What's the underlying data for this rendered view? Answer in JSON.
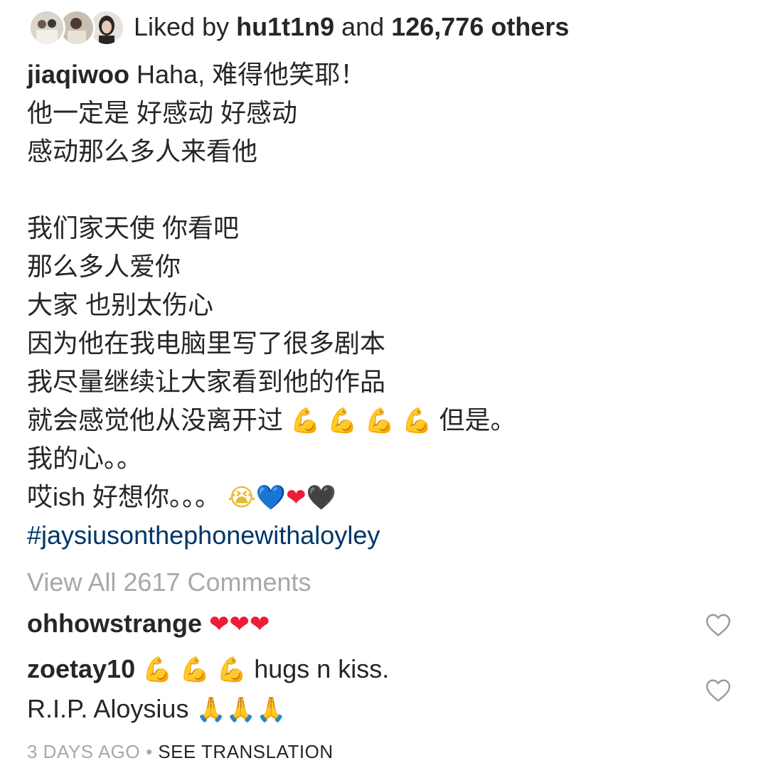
{
  "likes": {
    "prefix": "Liked by ",
    "user": "hu1t1n9",
    "middle": " and ",
    "count": "126,776 others"
  },
  "caption": {
    "username": "jiaqiwoo",
    "lines": [
      "Haha, 难得他笑耶！",
      "他一定是 好感动 好感动",
      "感动那么多人来看他",
      "",
      "我们家天使 你看吧",
      "那么多人爱你",
      "大家 也别太伤心",
      "因为他在我电脑里写了很多剧本",
      "我尽量继续让大家看到他的作品",
      "就会感觉他从没离开过",
      "但是。",
      "我的心。。",
      "哎ish 好想你。。。"
    ],
    "hashtag": "#jaysiusonthephonewithaloyley"
  },
  "view_all_comments": "View All 2617 Comments",
  "comments": [
    {
      "username": "ohhowstrange",
      "text": ""
    },
    {
      "username": "zoetay10",
      "text": "hugs n kiss.",
      "text2": "R.I.P. Aloysius"
    }
  ],
  "meta": {
    "time": "3 DAYS AGO",
    "separator": "•",
    "translate": "SEE TRANSLATION"
  },
  "icons": {
    "flexed_biceps": "💪",
    "crying_face": "😭",
    "blue_heart": "💙",
    "red_heart": "❤",
    "black_heart": "🖤",
    "folded_hands": "🙏",
    "like": "heart-outline-icon"
  },
  "colors": {
    "text": "#262626",
    "secondary": "#a8a8a8",
    "hashtag": "#003569"
  }
}
